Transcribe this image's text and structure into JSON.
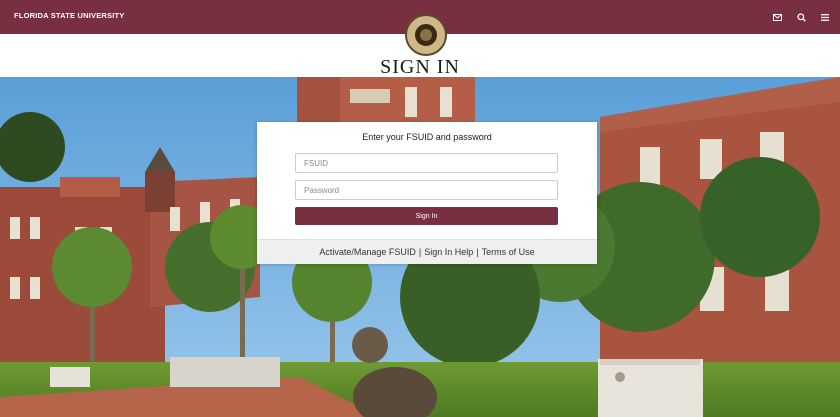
{
  "header": {
    "brand": "FLORIDA STATE UNIVERSITY",
    "icons": [
      "mail-icon",
      "search-icon",
      "menu-icon"
    ]
  },
  "title": "SIGN IN",
  "login": {
    "heading": "Enter your FSUID and password",
    "username_placeholder": "FSUID",
    "password_placeholder": "Password",
    "submit_label": "Sign In",
    "links": [
      "Activate/Manage FSUID",
      "Sign In Help",
      "Terms of Use"
    ],
    "separator": "|"
  },
  "colors": {
    "garnet": "#782f40",
    "gold": "#ceb888"
  }
}
